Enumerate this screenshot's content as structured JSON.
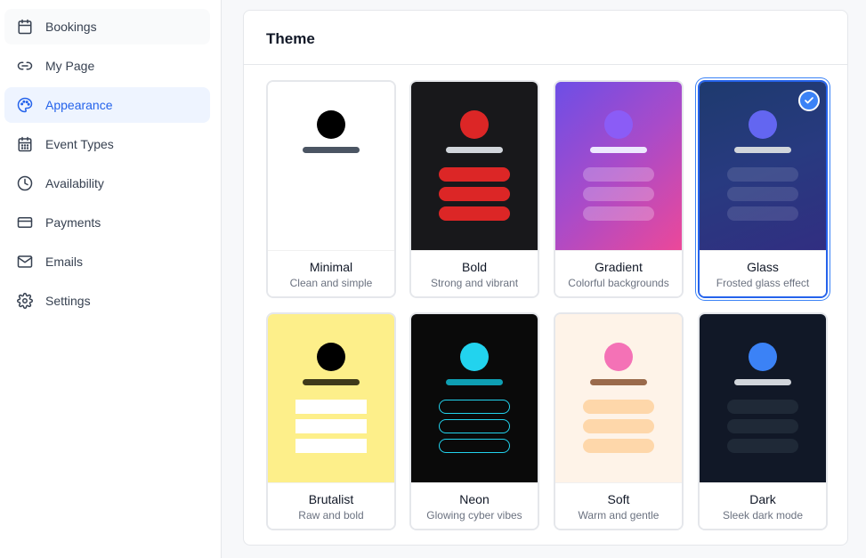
{
  "sidebar": {
    "items": [
      {
        "label": "Bookings",
        "icon": "calendar-icon"
      },
      {
        "label": "My Page",
        "icon": "link-icon"
      },
      {
        "label": "Appearance",
        "icon": "palette-icon",
        "active": true
      },
      {
        "label": "Event Types",
        "icon": "calendar-grid-icon"
      },
      {
        "label": "Availability",
        "icon": "clock-icon"
      },
      {
        "label": "Payments",
        "icon": "credit-card-icon"
      },
      {
        "label": "Emails",
        "icon": "mail-icon"
      },
      {
        "label": "Settings",
        "icon": "gear-icon"
      }
    ]
  },
  "theme_section": {
    "title": "Theme",
    "selected": "Glass",
    "themes": [
      {
        "name": "Minimal",
        "description": "Clean and simple"
      },
      {
        "name": "Bold",
        "description": "Strong and vibrant"
      },
      {
        "name": "Gradient",
        "description": "Colorful backgrounds"
      },
      {
        "name": "Glass",
        "description": "Frosted glass effect"
      },
      {
        "name": "Brutalist",
        "description": "Raw and bold"
      },
      {
        "name": "Neon",
        "description": "Glowing cyber vibes"
      },
      {
        "name": "Soft",
        "description": "Warm and gentle"
      },
      {
        "name": "Dark",
        "description": "Sleek dark mode"
      }
    ]
  },
  "colors": {
    "accent": "#2563eb",
    "active_nav_bg": "#eef4ff",
    "bold_red": "#dc2626",
    "neon_cyan": "#22d3ee",
    "soft_pink": "#f472b6",
    "dark_blue": "#3b82f6"
  }
}
